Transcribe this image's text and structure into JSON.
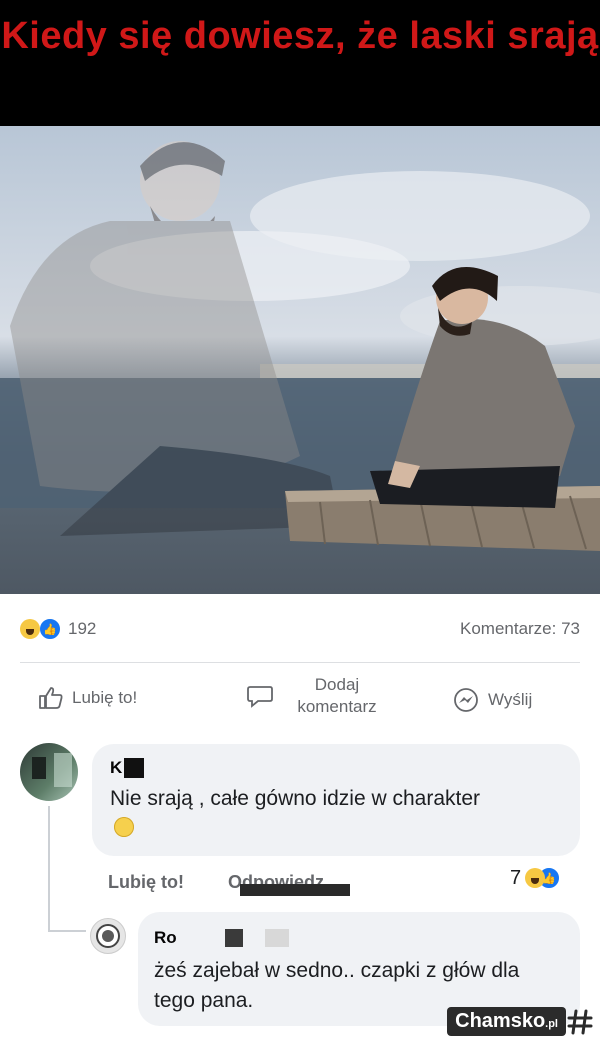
{
  "meme": {
    "caption": "Kiedy się dowiesz, że laski srają"
  },
  "post": {
    "reaction_count": "192",
    "comments_label": "Komentarze: 73",
    "actions": {
      "like": "Lubię to!",
      "comment": "Dodaj komentarz",
      "send": "Wyślij"
    }
  },
  "comments": [
    {
      "author": "K",
      "text": "Nie srają , całe gówno idzie w charakter",
      "like_label": "Lubię to!",
      "reply_label": "Odpowiedz",
      "reaction_count": "7"
    },
    {
      "author": "Ro",
      "text": "żeś zajebał w sedno.. czapki z głów dla tego pana."
    }
  ],
  "watermark": {
    "brand": "Chamsko",
    "tld": ".pl"
  },
  "colors": {
    "caption": "#d01818",
    "facebook_blue": "#1877f2",
    "muted_text": "#65676b",
    "bubble": "#f0f2f5"
  }
}
